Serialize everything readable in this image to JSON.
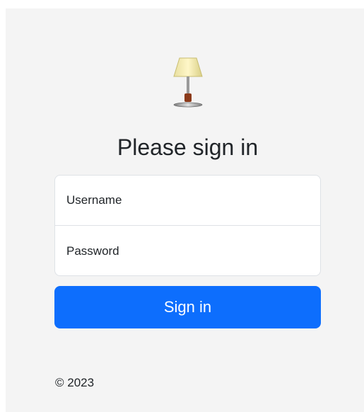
{
  "page": {
    "title": "Please sign in",
    "logo_icon": "table-lamp-icon"
  },
  "form": {
    "username_placeholder": "Username",
    "username_value": "",
    "password_placeholder": "Password",
    "password_value": "",
    "submit_label": "Sign in"
  },
  "footer": {
    "copyright": "© 2023"
  },
  "colors": {
    "background": "#f4f4f4",
    "primary": "#0d6efd",
    "text": "#212529",
    "border": "#dee2e6"
  }
}
